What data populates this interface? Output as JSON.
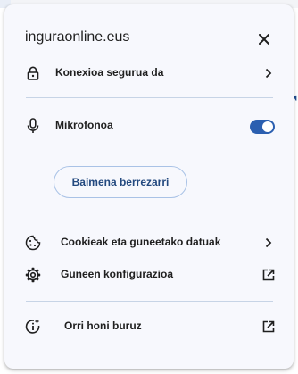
{
  "popup": {
    "title": "inguraonline.eus",
    "close_icon": "close-icon"
  },
  "connection": {
    "label": "Konexioa segurua da",
    "icon": "lock-icon",
    "trailing_icon": "chevron-right-icon"
  },
  "microphone": {
    "label": "Mikrofonoa",
    "icon": "microphone-icon",
    "enabled": true
  },
  "reset_permission": {
    "label": "Baimena berrezarri"
  },
  "cookies": {
    "label": "Cookieak eta guneetako datuak",
    "icon": "cookie-icon",
    "trailing_icon": "chevron-right-icon"
  },
  "site_settings": {
    "label": "Guneen konfigurazioa",
    "icon": "gear-icon",
    "trailing_icon": "open-in-new-icon"
  },
  "about_page": {
    "label": "Orri honi buruz",
    "icon": "page-info-icon",
    "trailing_icon": "open-in-new-icon"
  },
  "colors": {
    "accent": "#2b5fb0",
    "button_text": "#23497f",
    "panel_bg": "#f7f8fd"
  }
}
